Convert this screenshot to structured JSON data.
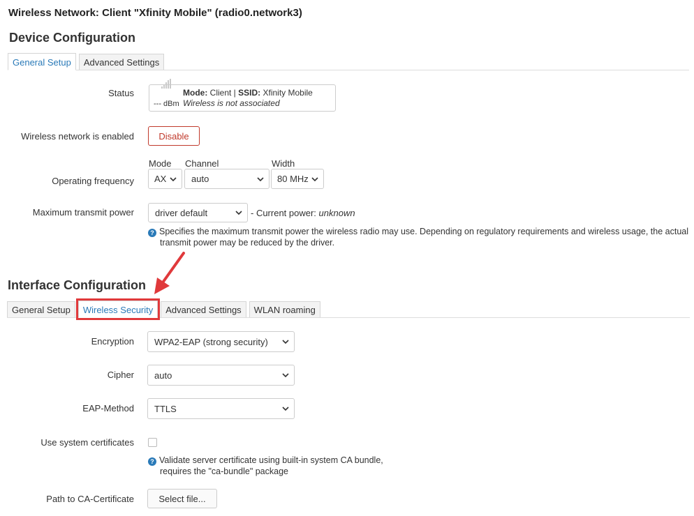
{
  "page_title": "Wireless Network: Client \"Xfinity Mobile\" (radio0.network3)",
  "device_config": {
    "title": "Device Configuration",
    "tabs": [
      {
        "label": "General Setup",
        "active": true
      },
      {
        "label": "Advanced Settings",
        "active": false
      }
    ],
    "status": {
      "label": "Status",
      "dbm": "--- dBm",
      "mode_key": "Mode:",
      "mode_value": " Client | ",
      "ssid_key": "SSID:",
      "ssid_value": " Xfinity Mobile",
      "association": "Wireless is not associated"
    },
    "enabled": {
      "label": "Wireless network is enabled",
      "button": "Disable"
    },
    "frequency": {
      "label": "Operating frequency",
      "mode_label": "Mode",
      "mode_value": "AX",
      "channel_label": "Channel",
      "channel_value": "auto",
      "width_label": "Width",
      "width_value": "80 MHz"
    },
    "txpower": {
      "label": "Maximum transmit power",
      "value": "driver default",
      "current_prefix": "- Current power: ",
      "current_value": "unknown",
      "hint": "Specifies the maximum transmit power the wireless radio may use. Depending on regulatory requirements and wireless usage, the actual transmit power may be reduced by the driver."
    }
  },
  "interface_config": {
    "title": "Interface Configuration",
    "tabs": [
      {
        "label": "General Setup",
        "active": false
      },
      {
        "label": "Wireless Security",
        "active": true
      },
      {
        "label": "Advanced Settings",
        "active": false
      },
      {
        "label": "WLAN roaming",
        "active": false
      }
    ],
    "encryption": {
      "label": "Encryption",
      "value": "WPA2-EAP (strong security)"
    },
    "cipher": {
      "label": "Cipher",
      "value": "auto"
    },
    "eap_method": {
      "label": "EAP-Method",
      "value": "TTLS"
    },
    "system_certs": {
      "label": "Use system certificates",
      "checked": false,
      "hint_line1": "Validate server certificate using built-in system CA bundle,",
      "hint_line2": "requires the \"ca-bundle\" package"
    },
    "ca_cert": {
      "label": "Path to CA-Certificate",
      "button": "Select file..."
    }
  },
  "colors": {
    "accent": "#2a7ab8",
    "danger": "#c0392b",
    "highlight": "#e0393b"
  }
}
